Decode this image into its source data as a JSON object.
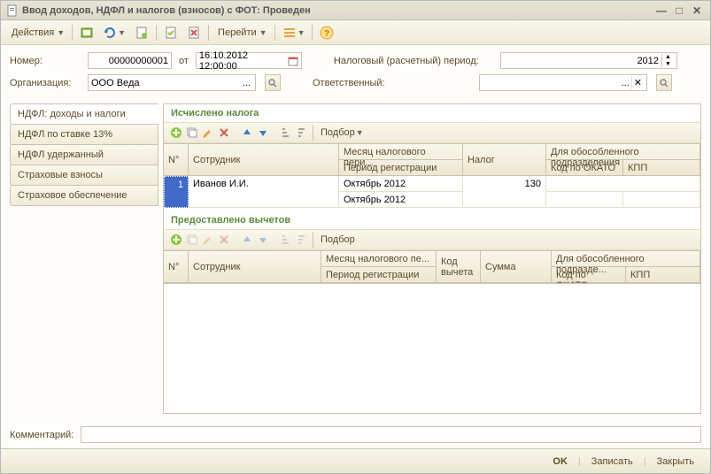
{
  "title": "Ввод доходов, НДФЛ и налогов (взносов) с ФОТ: Проведен",
  "toolbar": {
    "actions": "Действия",
    "goto": "Перейти"
  },
  "form": {
    "number_label": "Номер:",
    "number_value": "00000000001",
    "from_label": "от",
    "date_value": "16.10.2012 12:00:00",
    "tax_period_label": "Налоговый (расчетный) период:",
    "tax_period_value": "2012",
    "org_label": "Организация:",
    "org_value": "ООО Веда",
    "responsible_label": "Ответственный:",
    "responsible_value": ""
  },
  "tabs": {
    "items": [
      {
        "label": "НДФЛ: доходы и налоги"
      },
      {
        "label": "НДФЛ по ставке 13%"
      },
      {
        "label": "НДФЛ удержанный"
      },
      {
        "label": "Страховые взносы"
      },
      {
        "label": "Страховое обеспечение"
      }
    ],
    "active": 0
  },
  "section1": {
    "title": "Исчислено налога",
    "podbor": "Подбор",
    "headers": {
      "num": "N°",
      "employee": "Сотрудник",
      "tax_month": "Месяц налогового пери...",
      "reg_period": "Период регистрации",
      "tax": "Налог",
      "subdivision": "Для обособленного подразделения",
      "okato": "Код по ОКАТО",
      "kpp": "КПП"
    },
    "rows": [
      {
        "num": "1",
        "employee": "Иванов И.И.",
        "tax_month": "Октябрь 2012",
        "reg_period": "Октябрь 2012",
        "tax": "130"
      }
    ]
  },
  "section2": {
    "title": "Предоставлено вычетов",
    "podbor": "Подбор",
    "headers": {
      "num": "N°",
      "employee": "Сотрудник",
      "tax_month": "Месяц налогового пе...",
      "reg_period": "Период регистрации",
      "deduction_code": "Код вычета",
      "amount": "Сумма",
      "subdivision": "Для обособленного подразде...",
      "okato": "Код по ОКАТО",
      "kpp": "КПП"
    }
  },
  "comment": {
    "label": "Комментарий:",
    "value": ""
  },
  "footer": {
    "ok": "OK",
    "save": "Записать",
    "close": "Закрыть"
  }
}
